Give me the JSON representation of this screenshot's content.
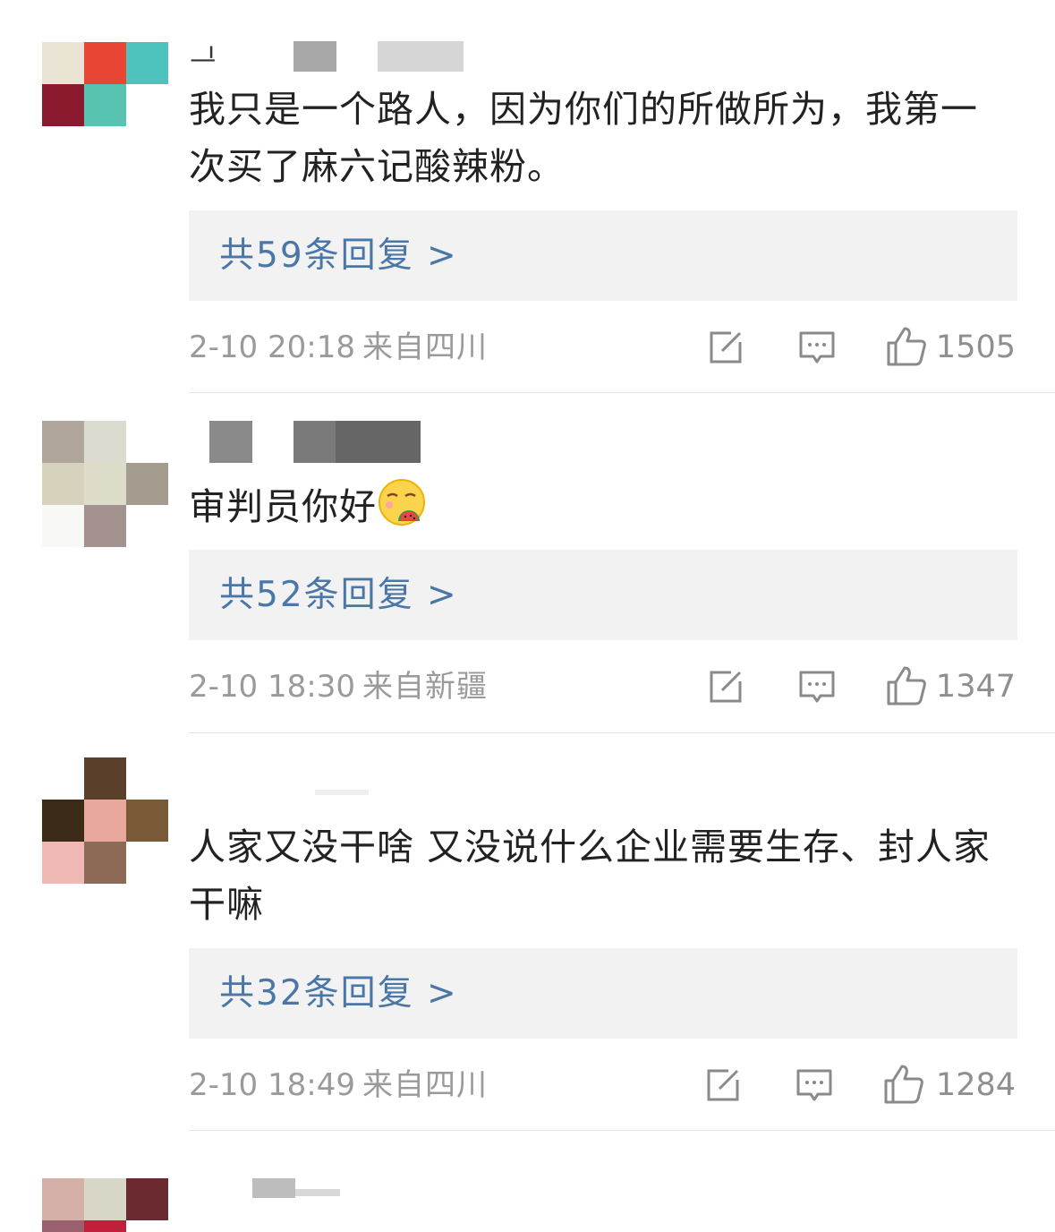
{
  "comments": [
    {
      "text": "我只是一个路人，因为你们的所做所为，我第一次买了麻六记酸辣粉。",
      "reply_label": "共59条回复 >",
      "time": "2-10 20:18",
      "location": "来自四川",
      "likes": "1505"
    },
    {
      "text": "审判员你好",
      "emoji": "savoring-watermelon-emoji",
      "reply_label": "共52条回复 >",
      "time": "2-10 18:30",
      "location": "来自新疆",
      "likes": "1347"
    },
    {
      "text": "人家又没干啥 又没说什么企业需要生存、封人家干嘛",
      "reply_label": "共32条回复 >",
      "time": "2-10 18:49",
      "location": "来自四川",
      "likes": "1284"
    }
  ],
  "icons": {
    "repost": "repost-icon",
    "reply": "reply-icon",
    "like": "thumbs-up-icon"
  },
  "colors": {
    "link": "#4a77a8",
    "meta": "#9a9a9a",
    "reply_bg": "#f2f2f2",
    "text": "#222222"
  }
}
